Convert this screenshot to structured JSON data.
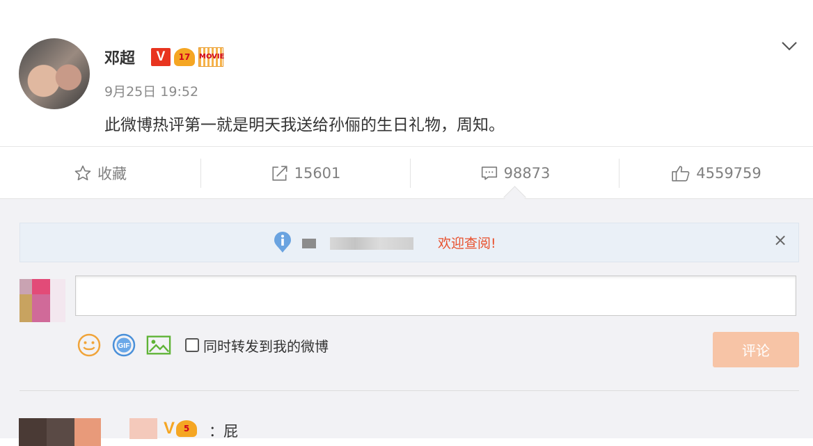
{
  "post": {
    "author": "邓超",
    "badges": {
      "verified": "V",
      "crown": "17",
      "movie": "MOVIE"
    },
    "timestamp": "9月25日 19:52",
    "content": "此微博热评第一就是明天我送给孙俪的生日礼物，周知。"
  },
  "actions": {
    "favorite_label": "收藏",
    "repost_count": "15601",
    "comment_count": "98873",
    "like_count": "4559759"
  },
  "notice": {
    "text": "欢迎查阅!",
    "close": "×"
  },
  "composer": {
    "input_value": "",
    "forward_label": "同时转发到我的微博",
    "submit_label": "评论",
    "tool_icons": [
      "emoji-icon",
      "gif-icon",
      "image-icon"
    ]
  },
  "first_comment": {
    "verified": "V",
    "crown": "5",
    "text": "：屁"
  },
  "colors": {
    "accent": "#e8502d",
    "submit_disabled": "#f7c4a6",
    "verified_red": "#e8341f",
    "verified_gold": "#f5a623"
  }
}
